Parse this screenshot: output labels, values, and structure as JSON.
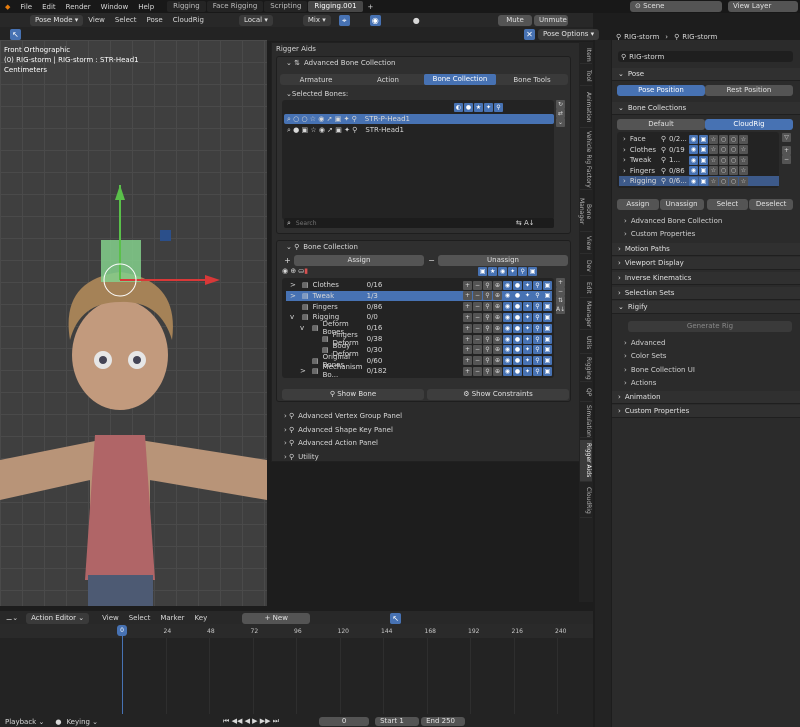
{
  "topbar": {
    "menus": [
      "File",
      "Edit",
      "Render",
      "Window",
      "Help"
    ],
    "workspaces": [
      "Rigging",
      "Face Rigging",
      "Scripting",
      "Rigging.001"
    ],
    "active_workspace": "Rigging.001",
    "scene": "Scene",
    "view_layer": "View Layer"
  },
  "viewport_header": {
    "mode": "Pose Mode",
    "menus": [
      "View",
      "Select",
      "Pose",
      "CloudRig"
    ],
    "transform": "Local",
    "pivot": "Mix",
    "mute": "Mute",
    "unmute": "Unmute",
    "pose_options": "Pose Options"
  },
  "viewport": {
    "title": "Front Orthographic",
    "subtitle": "(0) RIG-storm | RIG-storm : STR-Head1",
    "units": "Centimeters"
  },
  "rigger": {
    "panel_title": "Rigger Aids",
    "adv_title": "Advanced Bone Collection",
    "tabs": [
      "Armature",
      "Action",
      "Bone Collection",
      "Bone Tools"
    ],
    "active_tab": "Bone Collection",
    "selected_label": "Selected Bones:",
    "selected_bones": [
      "STR-P-Head1",
      "STR-Head1"
    ],
    "search_placeholder": "Search",
    "bc_title": "Bone Collection",
    "assign": "Assign",
    "unassign": "Unassign",
    "tree": [
      {
        "name": "Clothes",
        "count": "0/16",
        "indent": 0,
        "expand": ">"
      },
      {
        "name": "Tweak",
        "count": "1/3",
        "indent": 0,
        "expand": ">",
        "selected": true
      },
      {
        "name": "Fingers",
        "count": "0/86",
        "indent": 0,
        "expand": ""
      },
      {
        "name": "Rigging",
        "count": "0/0",
        "indent": 0,
        "expand": "v"
      },
      {
        "name": "Deform Bones",
        "count": "0/16",
        "indent": 1,
        "expand": "v"
      },
      {
        "name": "Fingers Deform",
        "count": "0/38",
        "indent": 2,
        "expand": ""
      },
      {
        "name": "Body Deform",
        "count": "0/30",
        "indent": 2,
        "expand": ""
      },
      {
        "name": "Original Bones",
        "count": "0/60",
        "indent": 1,
        "expand": ""
      },
      {
        "name": "Mechanism Bo...",
        "count": "0/182",
        "indent": 1,
        "expand": ">"
      }
    ],
    "show_bone": "Show Bone",
    "show_constraints": "Show Constraints",
    "extra_panels": [
      "Advanced Vertex Group Panel",
      "Advanced Shape Key Panel",
      "Advanced Action Panel",
      "Utility"
    ]
  },
  "vtabs": [
    "Item",
    "Tool",
    "Animation",
    "Vehicle Rig Factory",
    "Bone Manager",
    "View",
    "Dev",
    "Edit",
    "Manager",
    "Utils",
    "Rigging",
    "QP",
    "Simulation",
    "Rigger Aids",
    "CloudRig"
  ],
  "active_vtab": "Rigger Aids",
  "props": {
    "object": "RIG-storm",
    "data": "RIG-storm",
    "armature_name": "RIG-storm",
    "pose_title": "Pose",
    "pose_position": "Pose Position",
    "rest_position": "Rest Position",
    "bc_title": "Bone Collections",
    "default_tab": "Default",
    "cloudrig_tab": "CloudRig",
    "bc_list": [
      {
        "name": "Face",
        "count": "0/2..."
      },
      {
        "name": "Clothes",
        "count": "0/19"
      },
      {
        "name": "Tweak",
        "count": "1..."
      },
      {
        "name": "Fingers",
        "count": "0/86"
      },
      {
        "name": "Rigging",
        "count": "0/6..."
      }
    ],
    "assign": "Assign",
    "unassign": "Unassign",
    "select": "Select",
    "deselect": "Deselect",
    "adv_bc": "Advanced Bone Collection",
    "custom_props": "Custom Properties",
    "sections": [
      "Motion Paths",
      "Viewport Display",
      "Inverse Kinematics",
      "Selection Sets",
      "Rigify"
    ],
    "generate_rig": "Generate Rig",
    "rigify_sub": [
      "Advanced",
      "Color Sets",
      "Bone Collection UI",
      "Actions"
    ],
    "bottom_sections": [
      "Animation",
      "Custom Properties"
    ]
  },
  "timeline": {
    "editor": "Action Editor",
    "menus": [
      "View",
      "Select",
      "Marker",
      "Key"
    ],
    "new_label": "New",
    "ticks": [
      "0",
      "24",
      "48",
      "72",
      "96",
      "120",
      "144",
      "168",
      "192",
      "216",
      "240"
    ],
    "playback": "Playback",
    "keying": "Keying",
    "current": "0",
    "start_label": "Start",
    "start": "1",
    "end_label": "End",
    "end": "250"
  },
  "colors": {
    "accent": "#4772b3",
    "bg": "#2b2b2b",
    "viewport": "#3f3f3f"
  }
}
